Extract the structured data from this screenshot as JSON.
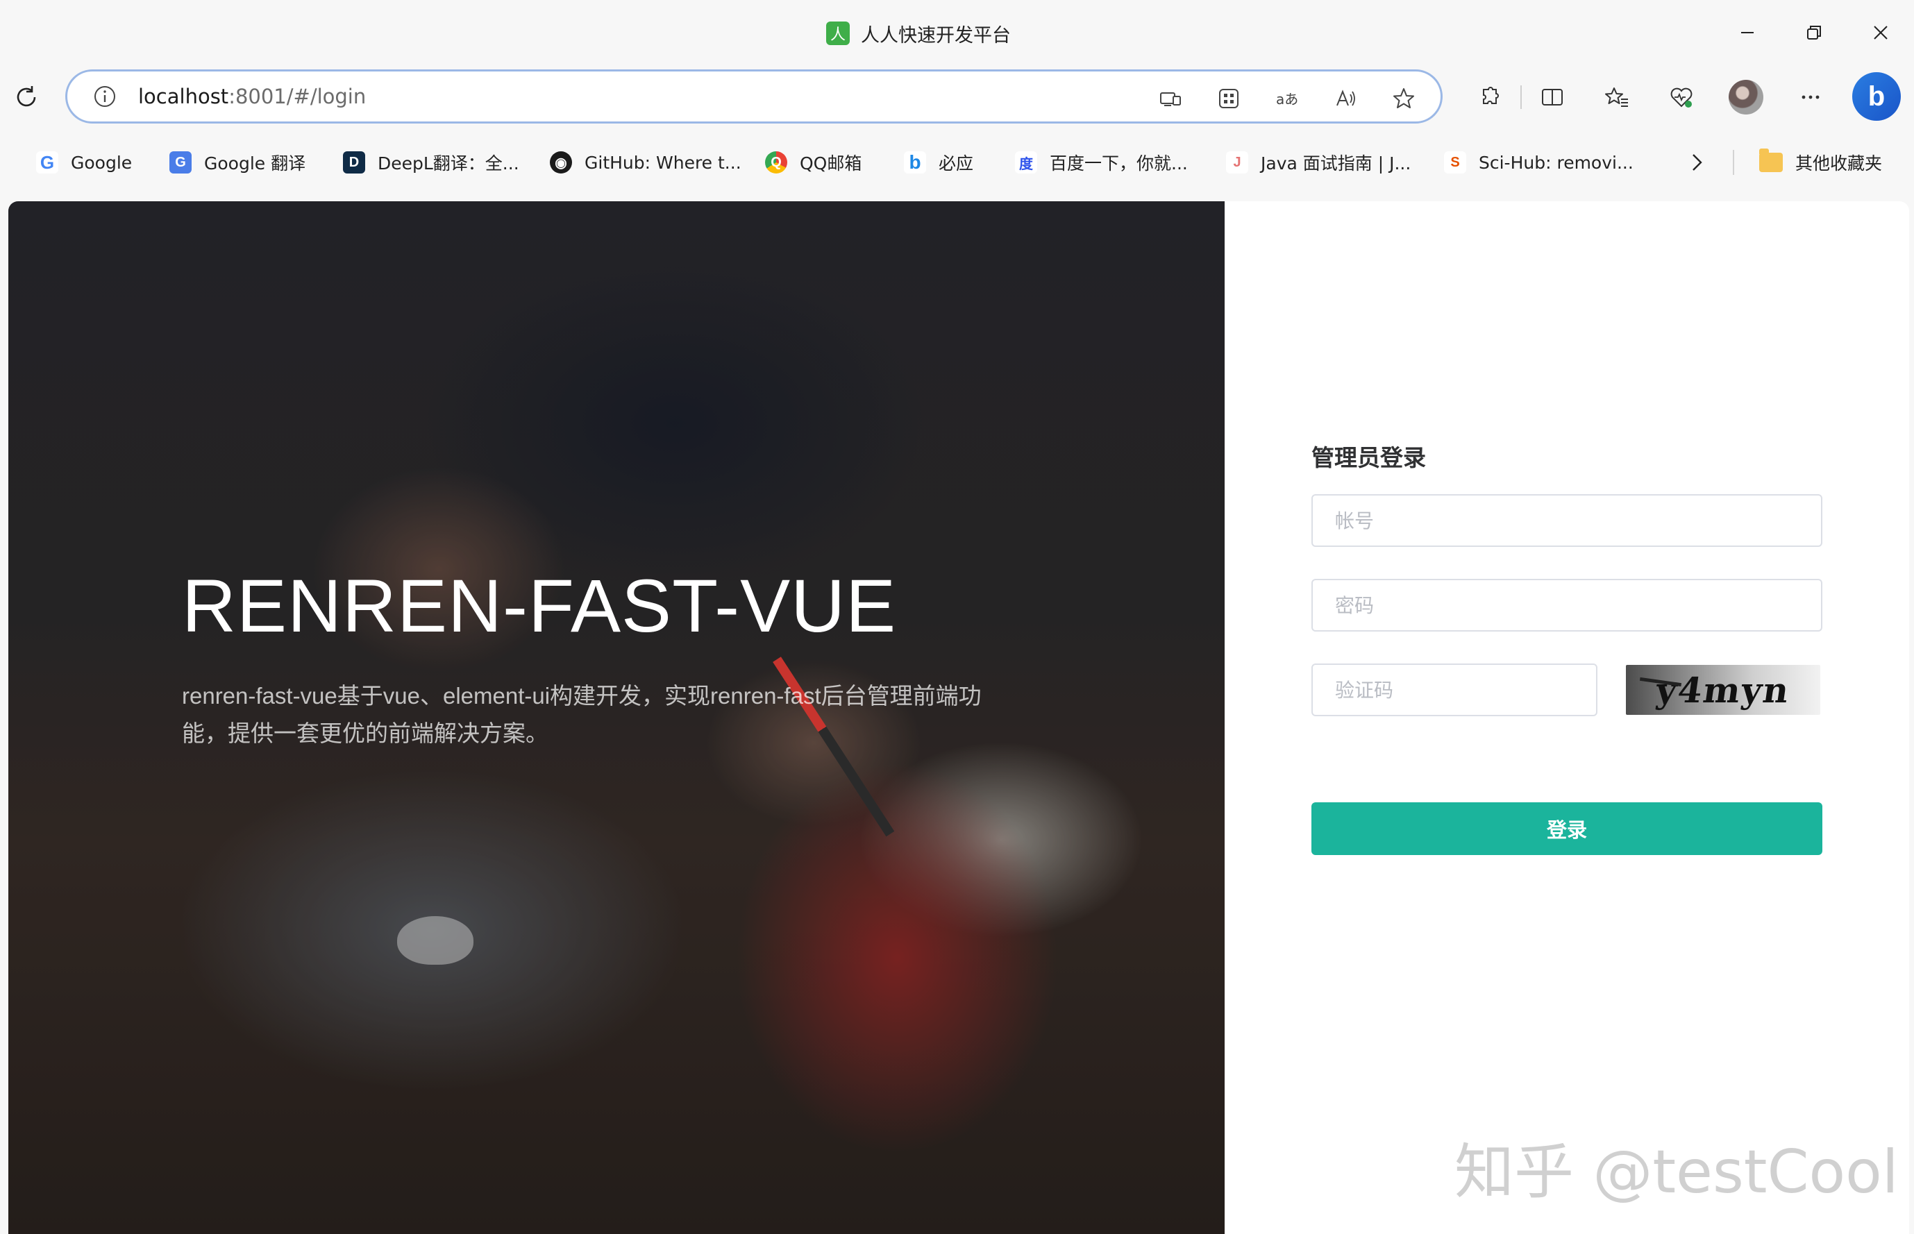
{
  "window": {
    "title": "人人快速开发平台",
    "app_icon_glyph": "人",
    "controls": [
      "minimize-icon",
      "restore-icon",
      "close-icon"
    ]
  },
  "navbar": {
    "url_host": "localhost",
    "url_path": ":8001/#/login",
    "omnibox_icons": [
      "app-available-icon",
      "apps-grid-icon",
      "translate-icon",
      "read-aloud-icon",
      "favorite-star-icon"
    ],
    "toolbar_icons": [
      "extensions-icon",
      "split-screen-icon",
      "favorites-icon",
      "browser-essentials-icon",
      "profile-avatar",
      "more-menu-icon",
      "copilot-icon"
    ],
    "copilot_glyph": "b"
  },
  "bookmarks": [
    {
      "label": "Google",
      "icon": "G",
      "color": "#4285f4"
    },
    {
      "label": "Google 翻译",
      "icon": "G",
      "color": "#4a7de8"
    },
    {
      "label": "DeepL翻译：全...",
      "icon": "D",
      "color": "#0f2b46"
    },
    {
      "label": "GitHub: Where t...",
      "icon": "◉",
      "color": "#1b1b1b"
    },
    {
      "label": "QQ邮箱",
      "icon": "Q",
      "color": "#3dae49"
    },
    {
      "label": "必应",
      "icon": "b",
      "color": "#1e88e5"
    },
    {
      "label": "百度一下，你就...",
      "icon": "度",
      "color": "#2f54eb"
    },
    {
      "label": "Java 面试指南 | J...",
      "icon": "J",
      "color": "#e57373"
    },
    {
      "label": "Sci-Hub: removi...",
      "icon": "S",
      "color": "#e65100"
    }
  ],
  "bookmarks_other": "其他收藏夹",
  "hero": {
    "title": "RENREN-FAST-VUE",
    "description": "renren-fast-vue基于vue、element-ui构建开发，实现renren-fast后台管理前端功能，提供一套更优的前端解决方案。"
  },
  "login": {
    "title": "管理员登录",
    "username_placeholder": "帐号",
    "password_placeholder": "密码",
    "captcha_placeholder": "验证码",
    "captcha_text": "y4myn",
    "submit_label": "登录"
  },
  "watermark": "知乎 @testCool"
}
